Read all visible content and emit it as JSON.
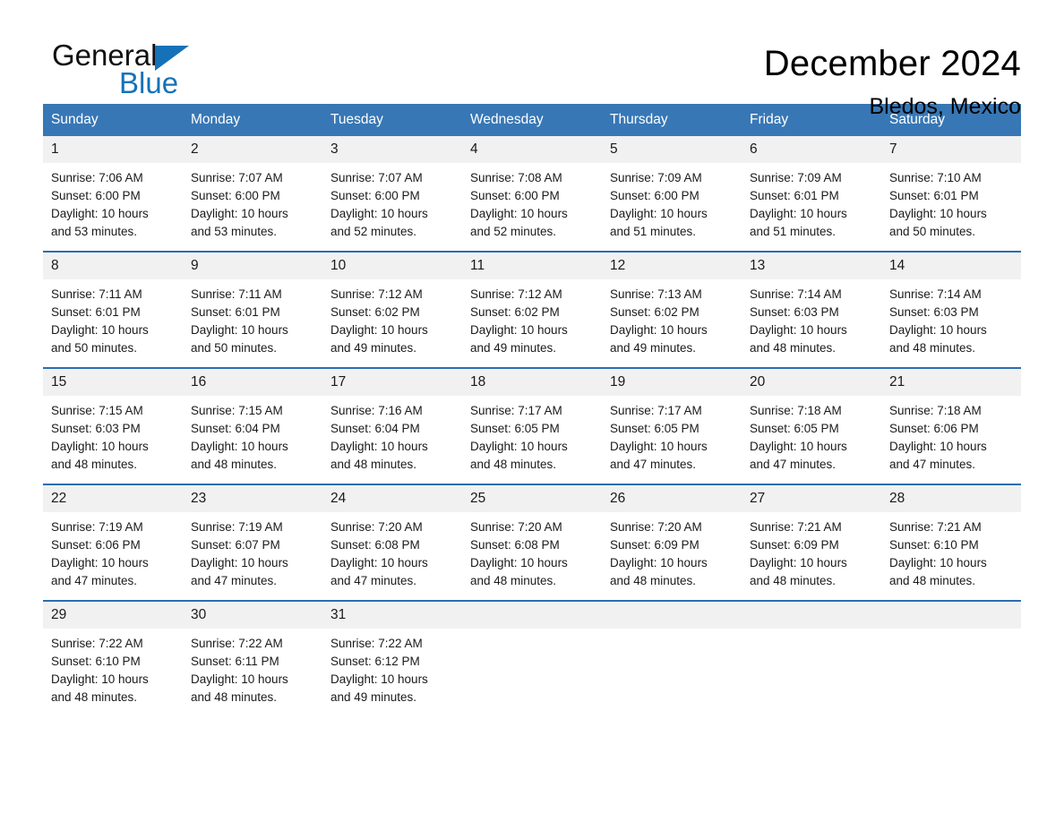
{
  "brand": {
    "name_part1": "General",
    "name_part2": "Blue",
    "logo_icon": "triangle-flag-icon",
    "accent_color": "#1572b8"
  },
  "header": {
    "title": "December 2024",
    "location": "Bledos, Mexico"
  },
  "calendar": {
    "header_bg": "#3877b5",
    "row_divider_color": "#2b6eb0",
    "daynum_bg": "#f1f1f1",
    "weekdays": [
      "Sunday",
      "Monday",
      "Tuesday",
      "Wednesday",
      "Thursday",
      "Friday",
      "Saturday"
    ],
    "weeks": [
      [
        {
          "day": "1",
          "sunrise": "Sunrise: 7:06 AM",
          "sunset": "Sunset: 6:00 PM",
          "daylight_l1": "Daylight: 10 hours",
          "daylight_l2": "and 53 minutes."
        },
        {
          "day": "2",
          "sunrise": "Sunrise: 7:07 AM",
          "sunset": "Sunset: 6:00 PM",
          "daylight_l1": "Daylight: 10 hours",
          "daylight_l2": "and 53 minutes."
        },
        {
          "day": "3",
          "sunrise": "Sunrise: 7:07 AM",
          "sunset": "Sunset: 6:00 PM",
          "daylight_l1": "Daylight: 10 hours",
          "daylight_l2": "and 52 minutes."
        },
        {
          "day": "4",
          "sunrise": "Sunrise: 7:08 AM",
          "sunset": "Sunset: 6:00 PM",
          "daylight_l1": "Daylight: 10 hours",
          "daylight_l2": "and 52 minutes."
        },
        {
          "day": "5",
          "sunrise": "Sunrise: 7:09 AM",
          "sunset": "Sunset: 6:00 PM",
          "daylight_l1": "Daylight: 10 hours",
          "daylight_l2": "and 51 minutes."
        },
        {
          "day": "6",
          "sunrise": "Sunrise: 7:09 AM",
          "sunset": "Sunset: 6:01 PM",
          "daylight_l1": "Daylight: 10 hours",
          "daylight_l2": "and 51 minutes."
        },
        {
          "day": "7",
          "sunrise": "Sunrise: 7:10 AM",
          "sunset": "Sunset: 6:01 PM",
          "daylight_l1": "Daylight: 10 hours",
          "daylight_l2": "and 50 minutes."
        }
      ],
      [
        {
          "day": "8",
          "sunrise": "Sunrise: 7:11 AM",
          "sunset": "Sunset: 6:01 PM",
          "daylight_l1": "Daylight: 10 hours",
          "daylight_l2": "and 50 minutes."
        },
        {
          "day": "9",
          "sunrise": "Sunrise: 7:11 AM",
          "sunset": "Sunset: 6:01 PM",
          "daylight_l1": "Daylight: 10 hours",
          "daylight_l2": "and 50 minutes."
        },
        {
          "day": "10",
          "sunrise": "Sunrise: 7:12 AM",
          "sunset": "Sunset: 6:02 PM",
          "daylight_l1": "Daylight: 10 hours",
          "daylight_l2": "and 49 minutes."
        },
        {
          "day": "11",
          "sunrise": "Sunrise: 7:12 AM",
          "sunset": "Sunset: 6:02 PM",
          "daylight_l1": "Daylight: 10 hours",
          "daylight_l2": "and 49 minutes."
        },
        {
          "day": "12",
          "sunrise": "Sunrise: 7:13 AM",
          "sunset": "Sunset: 6:02 PM",
          "daylight_l1": "Daylight: 10 hours",
          "daylight_l2": "and 49 minutes."
        },
        {
          "day": "13",
          "sunrise": "Sunrise: 7:14 AM",
          "sunset": "Sunset: 6:03 PM",
          "daylight_l1": "Daylight: 10 hours",
          "daylight_l2": "and 48 minutes."
        },
        {
          "day": "14",
          "sunrise": "Sunrise: 7:14 AM",
          "sunset": "Sunset: 6:03 PM",
          "daylight_l1": "Daylight: 10 hours",
          "daylight_l2": "and 48 minutes."
        }
      ],
      [
        {
          "day": "15",
          "sunrise": "Sunrise: 7:15 AM",
          "sunset": "Sunset: 6:03 PM",
          "daylight_l1": "Daylight: 10 hours",
          "daylight_l2": "and 48 minutes."
        },
        {
          "day": "16",
          "sunrise": "Sunrise: 7:15 AM",
          "sunset": "Sunset: 6:04 PM",
          "daylight_l1": "Daylight: 10 hours",
          "daylight_l2": "and 48 minutes."
        },
        {
          "day": "17",
          "sunrise": "Sunrise: 7:16 AM",
          "sunset": "Sunset: 6:04 PM",
          "daylight_l1": "Daylight: 10 hours",
          "daylight_l2": "and 48 minutes."
        },
        {
          "day": "18",
          "sunrise": "Sunrise: 7:17 AM",
          "sunset": "Sunset: 6:05 PM",
          "daylight_l1": "Daylight: 10 hours",
          "daylight_l2": "and 48 minutes."
        },
        {
          "day": "19",
          "sunrise": "Sunrise: 7:17 AM",
          "sunset": "Sunset: 6:05 PM",
          "daylight_l1": "Daylight: 10 hours",
          "daylight_l2": "and 47 minutes."
        },
        {
          "day": "20",
          "sunrise": "Sunrise: 7:18 AM",
          "sunset": "Sunset: 6:05 PM",
          "daylight_l1": "Daylight: 10 hours",
          "daylight_l2": "and 47 minutes."
        },
        {
          "day": "21",
          "sunrise": "Sunrise: 7:18 AM",
          "sunset": "Sunset: 6:06 PM",
          "daylight_l1": "Daylight: 10 hours",
          "daylight_l2": "and 47 minutes."
        }
      ],
      [
        {
          "day": "22",
          "sunrise": "Sunrise: 7:19 AM",
          "sunset": "Sunset: 6:06 PM",
          "daylight_l1": "Daylight: 10 hours",
          "daylight_l2": "and 47 minutes."
        },
        {
          "day": "23",
          "sunrise": "Sunrise: 7:19 AM",
          "sunset": "Sunset: 6:07 PM",
          "daylight_l1": "Daylight: 10 hours",
          "daylight_l2": "and 47 minutes."
        },
        {
          "day": "24",
          "sunrise": "Sunrise: 7:20 AM",
          "sunset": "Sunset: 6:08 PM",
          "daylight_l1": "Daylight: 10 hours",
          "daylight_l2": "and 47 minutes."
        },
        {
          "day": "25",
          "sunrise": "Sunrise: 7:20 AM",
          "sunset": "Sunset: 6:08 PM",
          "daylight_l1": "Daylight: 10 hours",
          "daylight_l2": "and 48 minutes."
        },
        {
          "day": "26",
          "sunrise": "Sunrise: 7:20 AM",
          "sunset": "Sunset: 6:09 PM",
          "daylight_l1": "Daylight: 10 hours",
          "daylight_l2": "and 48 minutes."
        },
        {
          "day": "27",
          "sunrise": "Sunrise: 7:21 AM",
          "sunset": "Sunset: 6:09 PM",
          "daylight_l1": "Daylight: 10 hours",
          "daylight_l2": "and 48 minutes."
        },
        {
          "day": "28",
          "sunrise": "Sunrise: 7:21 AM",
          "sunset": "Sunset: 6:10 PM",
          "daylight_l1": "Daylight: 10 hours",
          "daylight_l2": "and 48 minutes."
        }
      ],
      [
        {
          "day": "29",
          "sunrise": "Sunrise: 7:22 AM",
          "sunset": "Sunset: 6:10 PM",
          "daylight_l1": "Daylight: 10 hours",
          "daylight_l2": "and 48 minutes."
        },
        {
          "day": "30",
          "sunrise": "Sunrise: 7:22 AM",
          "sunset": "Sunset: 6:11 PM",
          "daylight_l1": "Daylight: 10 hours",
          "daylight_l2": "and 48 minutes."
        },
        {
          "day": "31",
          "sunrise": "Sunrise: 7:22 AM",
          "sunset": "Sunset: 6:12 PM",
          "daylight_l1": "Daylight: 10 hours",
          "daylight_l2": "and 49 minutes."
        },
        {
          "day": "",
          "sunrise": "",
          "sunset": "",
          "daylight_l1": "",
          "daylight_l2": ""
        },
        {
          "day": "",
          "sunrise": "",
          "sunset": "",
          "daylight_l1": "",
          "daylight_l2": ""
        },
        {
          "day": "",
          "sunrise": "",
          "sunset": "",
          "daylight_l1": "",
          "daylight_l2": ""
        },
        {
          "day": "",
          "sunrise": "",
          "sunset": "",
          "daylight_l1": "",
          "daylight_l2": ""
        }
      ]
    ]
  }
}
